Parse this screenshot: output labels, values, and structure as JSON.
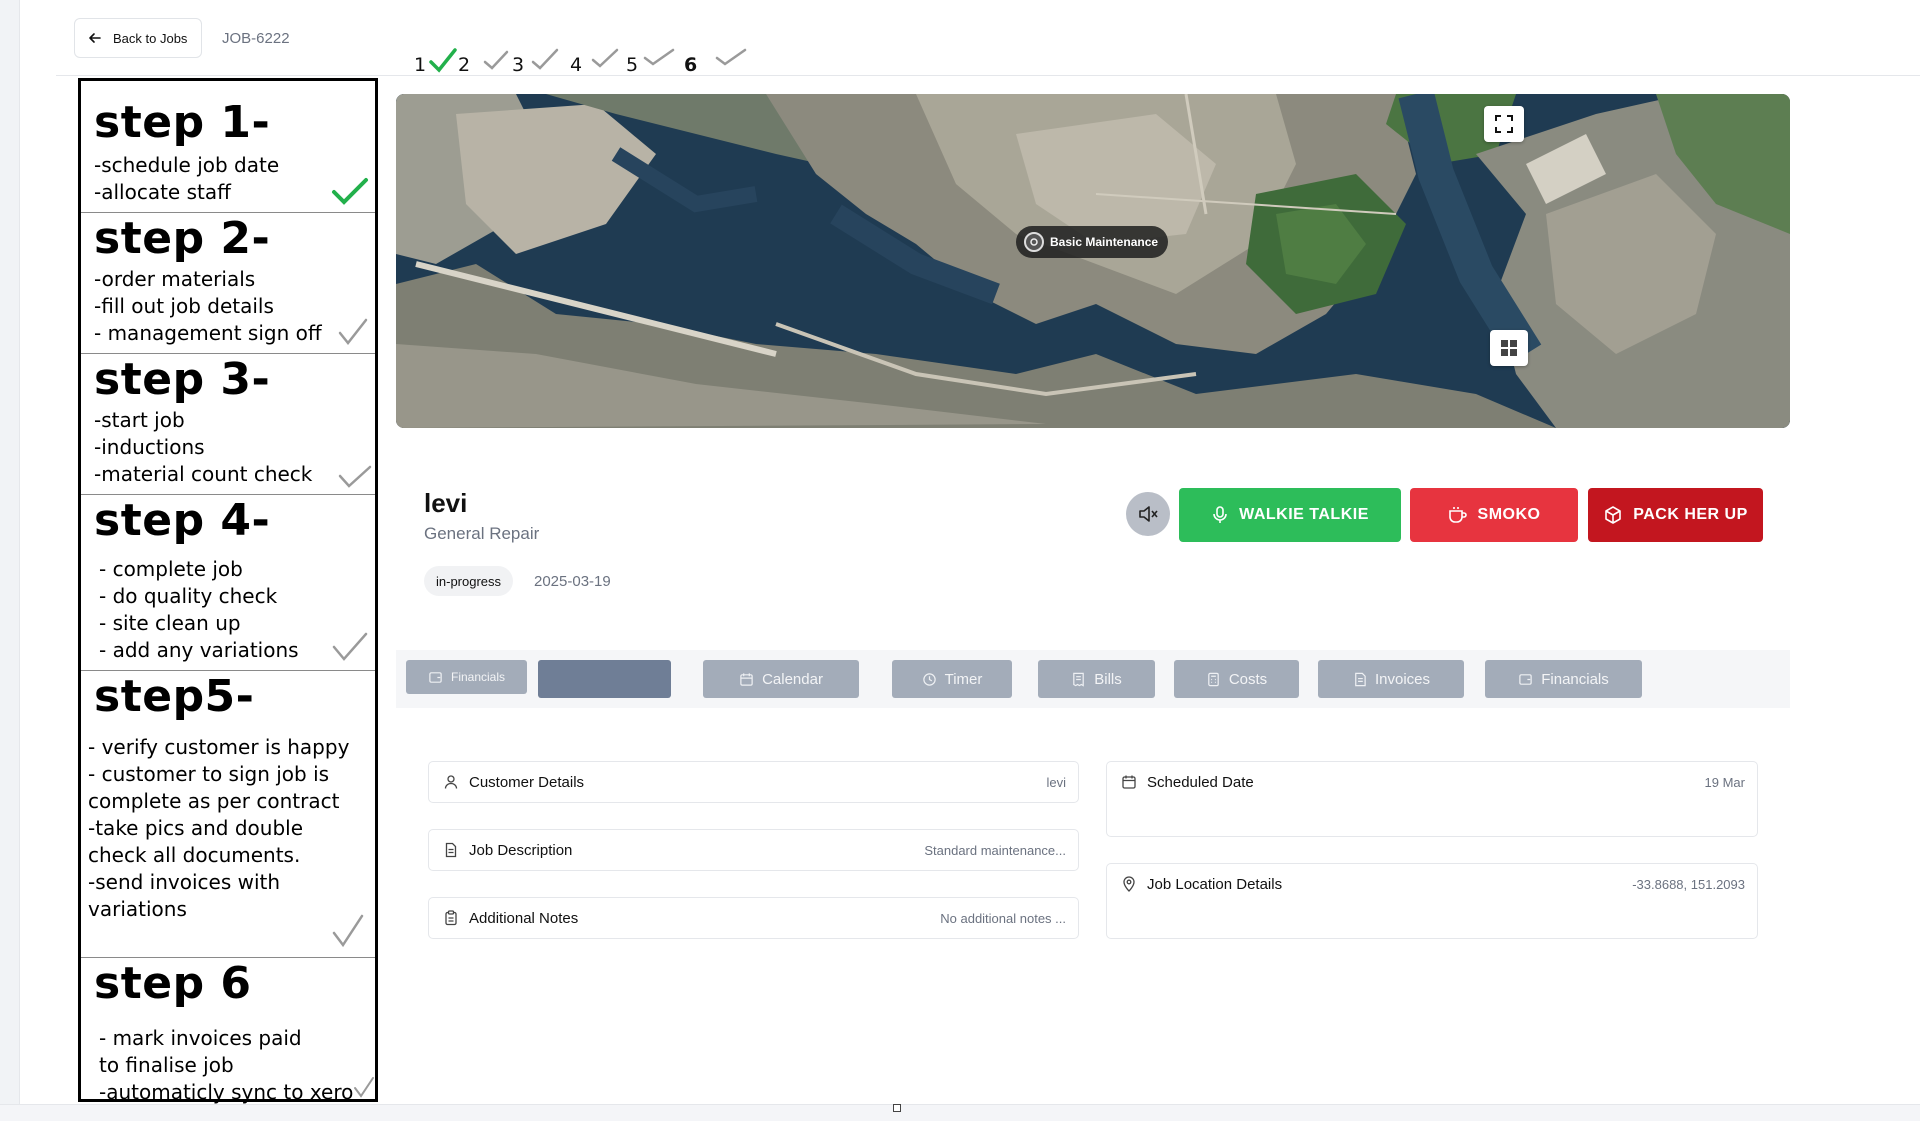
{
  "header": {
    "back_label": "Back to Jobs",
    "job_id": "JOB-6222"
  },
  "step_progress": [
    "1",
    "2",
    "3",
    "4",
    "5",
    "6"
  ],
  "steps": [
    {
      "title": "step 1-",
      "lines": [
        "-schedule job date",
        "-allocate staff"
      ],
      "done": true
    },
    {
      "title": "step 2-",
      "lines": [
        "-order materials",
        "-fill out job details",
        "- management sign off"
      ],
      "done": false
    },
    {
      "title": "step 3-",
      "lines": [
        "-start job",
        "-inductions",
        "-material count check"
      ],
      "done": false
    },
    {
      "title": "step 4-",
      "lines": [
        "- complete job",
        "- do quality check",
        "- site clean up",
        "- add any variations"
      ],
      "done": false
    },
    {
      "title": "step5-",
      "lines": [
        "- verify customer is happy",
        "- customer to sign job is",
        "complete as per contract",
        "-take pics and  double",
        "check all documents.",
        "-send invoices with",
        "variations"
      ],
      "done": false
    },
    {
      "title": "step 6",
      "lines": [
        "- mark invoices paid",
        "to finalise job",
        "-automaticly sync to xero"
      ],
      "done": false
    }
  ],
  "map": {
    "marker_label": "Basic Maintenance",
    "fullscreen_icon": "fullscreen-icon",
    "grid_icon": "grid-icon"
  },
  "job": {
    "customer_name": "levi",
    "job_type": "General Repair",
    "status": "in-progress",
    "date": "2025-03-19"
  },
  "actions": {
    "walkie_label": "WALKIE TALKIE",
    "smoko_label": "SMOKO",
    "pack_label": "PACK HER UP"
  },
  "tabs": [
    {
      "label": "Financials",
      "icon": "wallet-icon"
    },
    {
      "label": "",
      "icon": "",
      "active": true
    },
    {
      "label": "Calendar",
      "icon": "calendar-icon"
    },
    {
      "label": "Timer",
      "icon": "clock-icon"
    },
    {
      "label": "Bills",
      "icon": "receipt-icon"
    },
    {
      "label": "Costs",
      "icon": "calculator-icon"
    },
    {
      "label": "Invoices",
      "icon": "invoice-icon"
    },
    {
      "label": "Financials",
      "icon": "wallet-icon"
    }
  ],
  "details": {
    "customer": {
      "label": "Customer Details",
      "value": "levi"
    },
    "description": {
      "label": "Job Description",
      "value": "Standard maintenance..."
    },
    "notes": {
      "label": "Additional Notes",
      "value": "No additional notes ..."
    },
    "scheduled": {
      "label": "Scheduled Date",
      "value": "19 Mar"
    },
    "location": {
      "label": "Job Location Details",
      "value": "-33.8688, 151.2093"
    }
  },
  "colors": {
    "walkie": "#2dbd5a",
    "smoko": "#e7343f",
    "pack": "#c3161f",
    "tab": "#a3acb9",
    "check_done": "#22b04b",
    "check_todo": "#9a9a9a"
  }
}
